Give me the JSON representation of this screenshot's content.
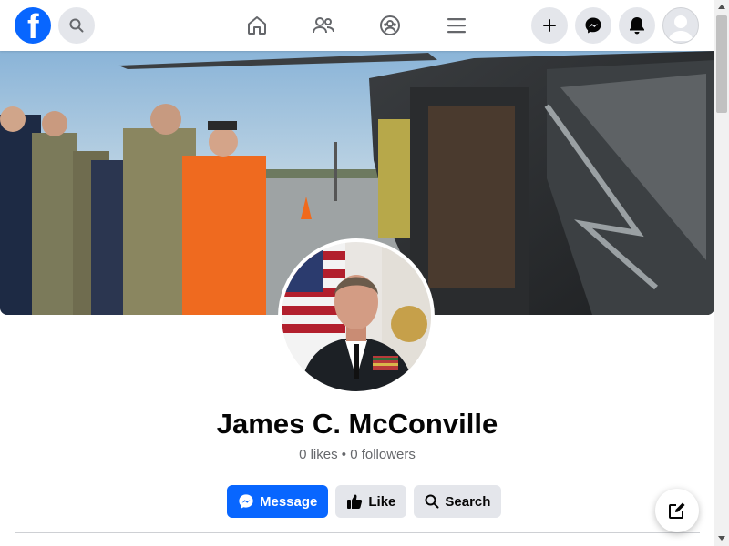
{
  "nav": {
    "logo_letter": "f",
    "icons": [
      "facebook-logo",
      "search-icon",
      "home-icon",
      "friends-icon",
      "groups-icon",
      "menu-icon",
      "plus-icon",
      "messenger-icon",
      "bell-icon",
      "avatar"
    ]
  },
  "profile": {
    "name": "James C. McConville",
    "stats": "0 likes • 0 followers"
  },
  "actions": {
    "message_label": "Message",
    "like_label": "Like",
    "search_label": "Search"
  },
  "colors": {
    "brand": "#0866ff",
    "secondary_button": "#e4e6eb",
    "muted_text": "#65676b"
  }
}
